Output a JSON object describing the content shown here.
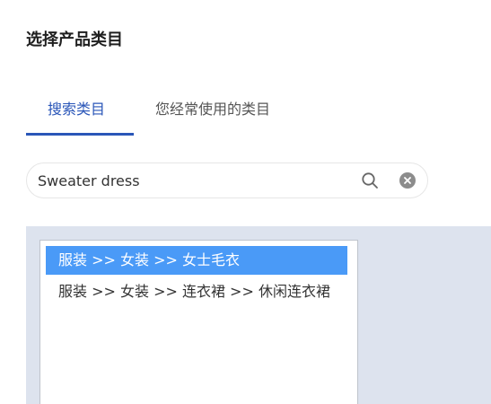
{
  "title": "选择产品类目",
  "tabs": [
    {
      "label": "搜索类目",
      "active": true
    },
    {
      "label": "您经常使用的类目",
      "active": false
    }
  ],
  "search": {
    "value": "Sweater dress",
    "search_icon": "search-icon",
    "clear_icon": "close-circle-icon"
  },
  "results": [
    {
      "label": "服装 >> 女装 >> 女士毛衣",
      "selected": true
    },
    {
      "label": "服装 >> 女装 >> 连衣裙 >> 休闲连衣裙",
      "selected": false
    }
  ],
  "colors": {
    "accent": "#2a56b8",
    "selected_bg": "#4a9af7",
    "panel_bg": "#dde3ee"
  }
}
